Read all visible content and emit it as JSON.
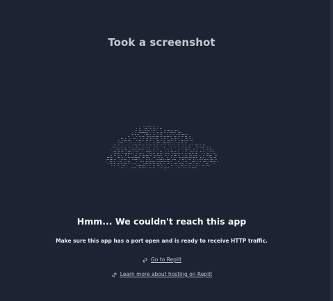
{
  "header": {
    "title": "Took a screenshot"
  },
  "error": {
    "heading": "Hmm... We couldn't reach this app",
    "message": "Make sure this app has a port open and is ready to receive HTTP traffic."
  },
  "links": {
    "go_to_replit": "Go to Replit",
    "learn_more": "Learn more about hosting on Replit"
  },
  "icons": {
    "cloud": "ascii-cloud-icon",
    "link": "link-icon"
  },
  "colors": {
    "background": "#1c2333",
    "text_primary": "#f5f9fc",
    "text_secondary": "#c2c8cc",
    "cloud": "#9da2a6"
  }
}
